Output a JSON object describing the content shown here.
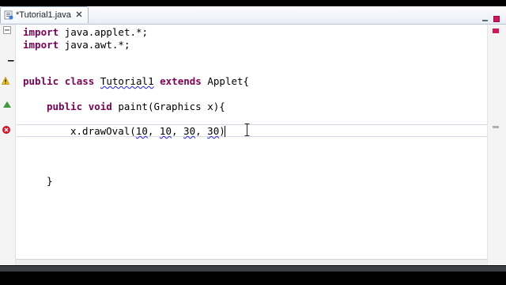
{
  "tab": {
    "title": "*Tutorial1.java"
  },
  "code": {
    "line1": {
      "kw": "import",
      "rest": " java.applet.*;"
    },
    "line2": {
      "kw": "import",
      "rest": " java.awt.*;"
    },
    "line3": {
      "dash": "–"
    },
    "line4": {
      "kw1": "public",
      "kw2": "class",
      "name": "Tutorial1",
      "kw3": "extends",
      "rest": " Applet{"
    },
    "line5": {
      "kw1": "public",
      "kw2": "void",
      "rest": " paint(Graphics x){"
    },
    "line6": {
      "pre": "x.drawOval(",
      "a": "10",
      "sep1": ", ",
      "b": "10",
      "sep2": ", ",
      "c": "30",
      "sep3": ", ",
      "d": "30",
      "post": ")"
    },
    "line7": {
      "text": "}"
    }
  },
  "colors": {
    "keyword": "#7f0055",
    "error": "#e81123",
    "accent": "#d4145a"
  },
  "icons": [
    "editor-tab-icon",
    "tab-close-icon",
    "error-icon",
    "warning-icon",
    "override-icon",
    "ibeam-cursor-icon"
  ]
}
